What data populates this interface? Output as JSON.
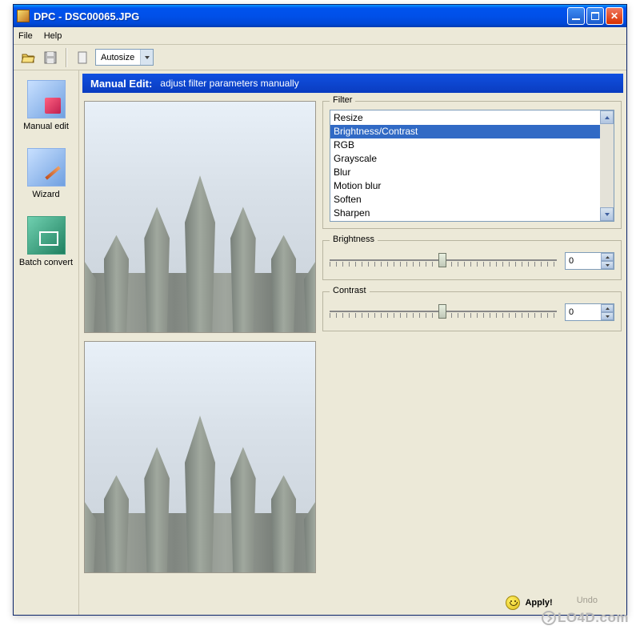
{
  "titlebar": {
    "title": "DPC - DSC00065.JPG"
  },
  "menu": {
    "file": "File",
    "help": "Help"
  },
  "toolbar": {
    "size_mode": "Autosize"
  },
  "sidebar": {
    "items": [
      {
        "label": "Manual edit"
      },
      {
        "label": "Wizard"
      },
      {
        "label": "Batch convert"
      }
    ]
  },
  "section": {
    "title": "Manual Edit:",
    "subtitle": "adjust filter parameters manually"
  },
  "filter_group": {
    "label": "Filter"
  },
  "filters": [
    "Resize",
    "Brightness/Contrast",
    "RGB",
    "Grayscale",
    "Blur",
    "Motion blur",
    "Soften",
    "Sharpen"
  ],
  "filter_selected_index": 1,
  "brightness": {
    "label": "Brightness",
    "value": "0"
  },
  "contrast": {
    "label": "Contrast",
    "value": "0"
  },
  "actions": {
    "apply": "Apply!",
    "undo": "Undo"
  },
  "watermark": "LO4D.com"
}
